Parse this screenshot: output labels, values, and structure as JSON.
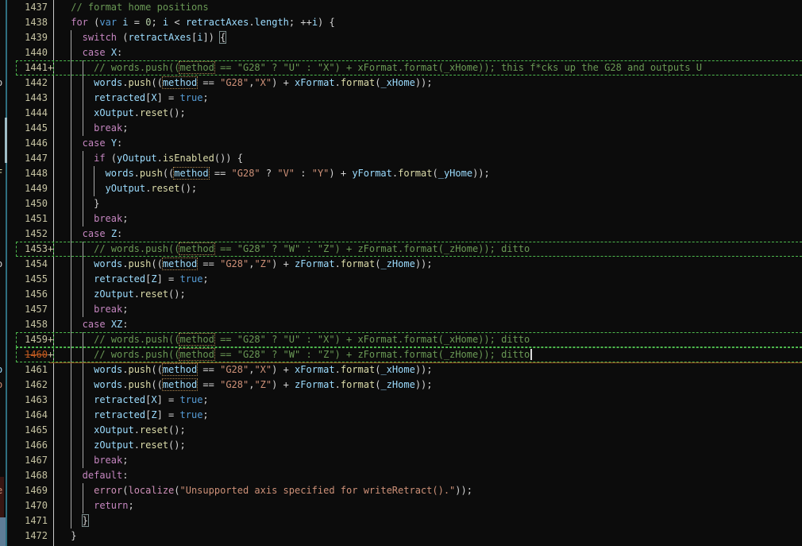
{
  "editor": {
    "background": "#0c0c0c",
    "colors": {
      "comment": "#6a9955",
      "keyword": "#c586c0",
      "keyword_blue": "#569cd6",
      "identifier": "#9cdcfe",
      "function": "#dcdcaa",
      "string": "#ce9178",
      "number": "#b5cea8",
      "punctuation": "#d4d4d4",
      "builtin_pink": "#ce8fb8",
      "line_number": "#c6c3a2",
      "current_line_number": "#c05a20",
      "modified_border_green": "#4db84d",
      "current_line_border_orange": "#95501d",
      "gutter_line": "#c9c9c9",
      "indent_guide": "#a9a9a9"
    },
    "left_strip": {
      "divider_color": "#2e6f80",
      "thumb_color": "#9fbec6",
      "maroon_block_color": "#381612",
      "bottom_block_color": "#5e7d97",
      "fragments": [
        {
          "row": 1442,
          "text": "o",
          "color": "#d4d4d4"
        },
        {
          "row": 1448,
          "text": "F",
          "color": "#dcdcaa"
        },
        {
          "row": 1454,
          "text": "o",
          "color": "#d4d4d4"
        },
        {
          "row": 1461,
          "text": "o",
          "color": "#9cdcfe"
        },
        {
          "row": 1462,
          "text": "o",
          "color": "#ce9178"
        },
        {
          "row": 1469,
          "text": "e",
          "color": "#ce9178"
        }
      ]
    },
    "first_line": 1437,
    "mod_marker": "+",
    "lines": [
      {
        "num": "1437",
        "ind": 1,
        "tokens": [
          [
            "cm",
            "// format home positions"
          ]
        ]
      },
      {
        "num": "1438",
        "ind": 1,
        "tokens": [
          [
            "kw",
            "for"
          ],
          [
            "pn",
            " ("
          ],
          [
            "kwb",
            "var"
          ],
          [
            "pn",
            " "
          ],
          [
            "id",
            "i"
          ],
          [
            "pn",
            " = "
          ],
          [
            "num",
            "0"
          ],
          [
            "pn",
            "; "
          ],
          [
            "id",
            "i"
          ],
          [
            "pn",
            " < "
          ],
          [
            "id",
            "retractAxes"
          ],
          [
            "pn",
            "."
          ],
          [
            "id",
            "length"
          ],
          [
            "pn",
            "; ++"
          ],
          [
            "id",
            "i"
          ],
          [
            "pn",
            ") {"
          ]
        ]
      },
      {
        "num": "1439",
        "ind": 3,
        "tokens": [
          [
            "kw",
            "switch"
          ],
          [
            "pn",
            " ("
          ],
          [
            "id",
            "retractAxes"
          ],
          [
            "pn",
            "["
          ],
          [
            "id",
            "i"
          ],
          [
            "pn",
            "]) "
          ],
          [
            "box",
            "{"
          ]
        ]
      },
      {
        "num": "1440",
        "ind": 3,
        "tokens": [
          [
            "kw",
            "case"
          ],
          [
            "pn",
            " "
          ],
          [
            "id",
            "X"
          ],
          [
            "pn",
            ":"
          ]
        ]
      },
      {
        "num": "1441",
        "ind": 5,
        "mod": true,
        "tokens": [
          [
            "cm",
            "// words.push(("
          ],
          [
            "cm-occ",
            "method"
          ],
          [
            "cm",
            " == \"G28\" ? \"U\" : \"X\") + xFormat.format(_xHome)); this f*cks up the G28 and outputs U"
          ]
        ]
      },
      {
        "num": "1442",
        "ind": 5,
        "tokens": [
          [
            "id",
            "words"
          ],
          [
            "pn",
            "."
          ],
          [
            "fn",
            "push"
          ],
          [
            "pn",
            "(("
          ],
          [
            "id-occ",
            "method"
          ],
          [
            "pn",
            " == "
          ],
          [
            "str",
            "\"G28\""
          ],
          [
            "pn",
            ","
          ],
          [
            "str",
            "\"X\""
          ],
          [
            "pn",
            ") + "
          ],
          [
            "id",
            "xFormat"
          ],
          [
            "pn",
            "."
          ],
          [
            "fn",
            "format"
          ],
          [
            "pn",
            "("
          ],
          [
            "id",
            "_xHome"
          ],
          [
            "pn",
            "));"
          ]
        ]
      },
      {
        "num": "1443",
        "ind": 5,
        "tokens": [
          [
            "id",
            "retracted"
          ],
          [
            "pn",
            "["
          ],
          [
            "id",
            "X"
          ],
          [
            "pn",
            "] = "
          ],
          [
            "kwb",
            "true"
          ],
          [
            "pn",
            ";"
          ]
        ]
      },
      {
        "num": "1444",
        "ind": 5,
        "tokens": [
          [
            "id",
            "xOutput"
          ],
          [
            "pn",
            "."
          ],
          [
            "fn",
            "reset"
          ],
          [
            "pn",
            "();"
          ]
        ]
      },
      {
        "num": "1445",
        "ind": 5,
        "tokens": [
          [
            "kw",
            "break"
          ],
          [
            "pn",
            ";"
          ]
        ]
      },
      {
        "num": "1446",
        "ind": 3,
        "tokens": [
          [
            "kw",
            "case"
          ],
          [
            "pn",
            " "
          ],
          [
            "id",
            "Y"
          ],
          [
            "pn",
            ":"
          ]
        ]
      },
      {
        "num": "1447",
        "ind": 5,
        "tokens": [
          [
            "kw",
            "if"
          ],
          [
            "pn",
            " ("
          ],
          [
            "id",
            "yOutput"
          ],
          [
            "pn",
            "."
          ],
          [
            "fn",
            "isEnabled"
          ],
          [
            "pn",
            "()) {"
          ]
        ]
      },
      {
        "num": "1448",
        "ind": 7,
        "tokens": [
          [
            "id",
            "words"
          ],
          [
            "pn",
            "."
          ],
          [
            "fn",
            "push"
          ],
          [
            "pn",
            "(("
          ],
          [
            "id-occ",
            "method"
          ],
          [
            "pn",
            " == "
          ],
          [
            "str",
            "\"G28\""
          ],
          [
            "pn",
            " ? "
          ],
          [
            "str",
            "\"V\""
          ],
          [
            "pn",
            " : "
          ],
          [
            "str",
            "\"Y\""
          ],
          [
            "pn",
            ") + "
          ],
          [
            "id",
            "yFormat"
          ],
          [
            "pn",
            "."
          ],
          [
            "fn",
            "format"
          ],
          [
            "pn",
            "("
          ],
          [
            "id",
            "_yHome"
          ],
          [
            "pn",
            "));"
          ]
        ]
      },
      {
        "num": "1449",
        "ind": 7,
        "tokens": [
          [
            "id",
            "yOutput"
          ],
          [
            "pn",
            "."
          ],
          [
            "fn",
            "reset"
          ],
          [
            "pn",
            "();"
          ]
        ]
      },
      {
        "num": "1450",
        "ind": 5,
        "tokens": [
          [
            "pn",
            "}"
          ]
        ]
      },
      {
        "num": "1451",
        "ind": 5,
        "tokens": [
          [
            "kw",
            "break"
          ],
          [
            "pn",
            ";"
          ]
        ]
      },
      {
        "num": "1452",
        "ind": 3,
        "tokens": [
          [
            "kw",
            "case"
          ],
          [
            "pn",
            " "
          ],
          [
            "id",
            "Z"
          ],
          [
            "pn",
            ":"
          ]
        ]
      },
      {
        "num": "1453",
        "ind": 5,
        "mod": true,
        "tokens": [
          [
            "cm",
            "// words.push(("
          ],
          [
            "cm-occ",
            "method"
          ],
          [
            "cm",
            " == \"G28\" ? \"W\" : \"Z\") + zFormat.format(_zHome)); ditto"
          ]
        ]
      },
      {
        "num": "1454",
        "ind": 5,
        "tokens": [
          [
            "id",
            "words"
          ],
          [
            "pn",
            "."
          ],
          [
            "fn",
            "push"
          ],
          [
            "pn",
            "(("
          ],
          [
            "id-occ",
            "method"
          ],
          [
            "pn",
            " == "
          ],
          [
            "str",
            "\"G28\""
          ],
          [
            "pn",
            ","
          ],
          [
            "str",
            "\"Z\""
          ],
          [
            "pn",
            ") + "
          ],
          [
            "id",
            "zFormat"
          ],
          [
            "pn",
            "."
          ],
          [
            "fn",
            "format"
          ],
          [
            "pn",
            "("
          ],
          [
            "id",
            "_zHome"
          ],
          [
            "pn",
            "));"
          ]
        ]
      },
      {
        "num": "1455",
        "ind": 5,
        "tokens": [
          [
            "id",
            "retracted"
          ],
          [
            "pn",
            "["
          ],
          [
            "id",
            "Z"
          ],
          [
            "pn",
            "] = "
          ],
          [
            "kwb",
            "true"
          ],
          [
            "pn",
            ";"
          ]
        ]
      },
      {
        "num": "1456",
        "ind": 5,
        "tokens": [
          [
            "id",
            "zOutput"
          ],
          [
            "pn",
            "."
          ],
          [
            "fn",
            "reset"
          ],
          [
            "pn",
            "();"
          ]
        ]
      },
      {
        "num": "1457",
        "ind": 5,
        "tokens": [
          [
            "kw",
            "break"
          ],
          [
            "pn",
            ";"
          ]
        ]
      },
      {
        "num": "1458",
        "ind": 3,
        "tokens": [
          [
            "kw",
            "case"
          ],
          [
            "pn",
            " "
          ],
          [
            "id",
            "XZ"
          ],
          [
            "pn",
            ":"
          ]
        ]
      },
      {
        "num": "1459",
        "ind": 5,
        "mod": true,
        "tokens": [
          [
            "cm",
            "// words.push(("
          ],
          [
            "cm-occ",
            "method"
          ],
          [
            "cm",
            " == \"G28\" ? \"U\" : \"X\") + xFormat.format(_xHome)); ditto"
          ]
        ]
      },
      {
        "num": "1460",
        "ind": 5,
        "mod": true,
        "cur": true,
        "tokens": [
          [
            "cm",
            "// words.push(("
          ],
          [
            "cm-occ",
            "method"
          ],
          [
            "cm",
            " == \"G28\" ? \"W\" : \"Z\") + zFormat.format(_zHome)); ditto"
          ]
        ]
      },
      {
        "num": "1461",
        "ind": 5,
        "tokens": [
          [
            "id",
            "words"
          ],
          [
            "pn",
            "."
          ],
          [
            "fn",
            "push"
          ],
          [
            "pn",
            "(("
          ],
          [
            "id-occ",
            "method"
          ],
          [
            "pn",
            " == "
          ],
          [
            "str",
            "\"G28\""
          ],
          [
            "pn",
            ","
          ],
          [
            "str",
            "\"X\""
          ],
          [
            "pn",
            ") + "
          ],
          [
            "id",
            "xFormat"
          ],
          [
            "pn",
            "."
          ],
          [
            "fn",
            "format"
          ],
          [
            "pn",
            "("
          ],
          [
            "id",
            "_xHome"
          ],
          [
            "pn",
            "));"
          ]
        ]
      },
      {
        "num": "1462",
        "ind": 5,
        "tokens": [
          [
            "id",
            "words"
          ],
          [
            "pn",
            "."
          ],
          [
            "fn",
            "push"
          ],
          [
            "pn",
            "(("
          ],
          [
            "id-occ",
            "method"
          ],
          [
            "pn",
            " == "
          ],
          [
            "str",
            "\"G28\""
          ],
          [
            "pn",
            ","
          ],
          [
            "str",
            "\"Z\""
          ],
          [
            "pn",
            ") + "
          ],
          [
            "id",
            "zFormat"
          ],
          [
            "pn",
            "."
          ],
          [
            "fn",
            "format"
          ],
          [
            "pn",
            "("
          ],
          [
            "id",
            "_zHome"
          ],
          [
            "pn",
            "));"
          ]
        ]
      },
      {
        "num": "1463",
        "ind": 5,
        "tokens": [
          [
            "id",
            "retracted"
          ],
          [
            "pn",
            "["
          ],
          [
            "id",
            "X"
          ],
          [
            "pn",
            "] = "
          ],
          [
            "kwb",
            "true"
          ],
          [
            "pn",
            ";"
          ]
        ]
      },
      {
        "num": "1464",
        "ind": 5,
        "tokens": [
          [
            "id",
            "retracted"
          ],
          [
            "pn",
            "["
          ],
          [
            "id",
            "Z"
          ],
          [
            "pn",
            "] = "
          ],
          [
            "kwb",
            "true"
          ],
          [
            "pn",
            ";"
          ]
        ]
      },
      {
        "num": "1465",
        "ind": 5,
        "tokens": [
          [
            "id",
            "xOutput"
          ],
          [
            "pn",
            "."
          ],
          [
            "fn",
            "reset"
          ],
          [
            "pn",
            "();"
          ]
        ]
      },
      {
        "num": "1466",
        "ind": 5,
        "tokens": [
          [
            "id",
            "zOutput"
          ],
          [
            "pn",
            "."
          ],
          [
            "fn",
            "reset"
          ],
          [
            "pn",
            "();"
          ]
        ]
      },
      {
        "num": "1467",
        "ind": 5,
        "tokens": [
          [
            "kw",
            "break"
          ],
          [
            "pn",
            ";"
          ]
        ]
      },
      {
        "num": "1468",
        "ind": 3,
        "tokens": [
          [
            "kw",
            "default"
          ],
          [
            "pn",
            ":"
          ]
        ]
      },
      {
        "num": "1469",
        "ind": 5,
        "tokens": [
          [
            "pink",
            "error"
          ],
          [
            "pn",
            "("
          ],
          [
            "pink",
            "localize"
          ],
          [
            "pn",
            "("
          ],
          [
            "str",
            "\"Unsupported axis specified for writeRetract().\""
          ],
          [
            "pn",
            "));"
          ]
        ]
      },
      {
        "num": "1470",
        "ind": 5,
        "tokens": [
          [
            "kw",
            "return"
          ],
          [
            "pn",
            ";"
          ]
        ]
      },
      {
        "num": "1471",
        "ind": 3,
        "tokens": [
          [
            "box",
            "}"
          ]
        ]
      },
      {
        "num": "1472",
        "ind": 1,
        "tokens": [
          [
            "pn",
            "}"
          ]
        ]
      }
    ]
  }
}
